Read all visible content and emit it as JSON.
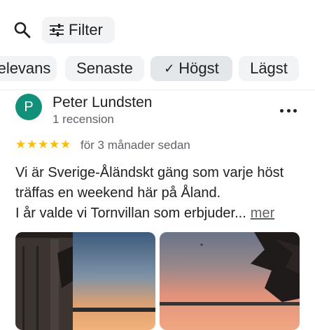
{
  "toolbar": {
    "search_icon": "search-icon",
    "filter_icon": "tune-icon",
    "filter_label": "Filter"
  },
  "sort_chips": [
    {
      "label": "elevans",
      "selected": false
    },
    {
      "label": "Senaste",
      "selected": false
    },
    {
      "label": "Högst",
      "selected": true,
      "icon": "check-icon"
    },
    {
      "label": "Lägst",
      "selected": false
    }
  ],
  "review": {
    "avatar_letter": "P",
    "avatar_color": "#12917a",
    "reviewer_name": "Peter Lundsten",
    "reviewer_sub": "1 recension",
    "rating": 5,
    "star_color": "#fbbc04",
    "time": "för 3 månader sedan",
    "text_lines": [
      "Vi är Sverige-Åländskt gäng som varje höst",
      "träffas en weekend här på Åland.",
      "I år valde vi Tornvillan som erbjuder..."
    ],
    "more_label": "mer",
    "more_icon": "more-vert-icon"
  },
  "colors": {
    "chip_bg": "#f1f3f4",
    "chip_selected_bg": "#e3e7ea",
    "secondary_text": "#5f6368"
  }
}
